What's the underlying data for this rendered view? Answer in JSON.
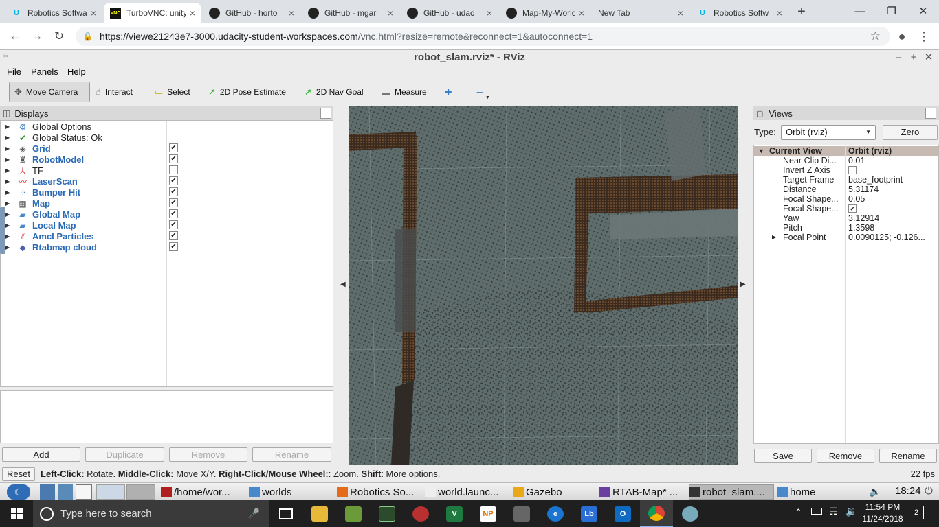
{
  "browser": {
    "tabs": [
      {
        "title": "Robotics Software",
        "icon": "udacity-icon",
        "active": false
      },
      {
        "title": "TurboVNC: unity",
        "icon": "turbovnc-icon",
        "active": true
      },
      {
        "title": "GitHub - horto",
        "icon": "github-icon",
        "active": false
      },
      {
        "title": "GitHub - mgar",
        "icon": "github-icon",
        "active": false
      },
      {
        "title": "GitHub - udac",
        "icon": "github-icon",
        "active": false
      },
      {
        "title": "Map-My-World",
        "icon": "github-icon",
        "active": false
      },
      {
        "title": "New Tab",
        "icon": "",
        "active": false
      },
      {
        "title": "Robotics Softw",
        "icon": "udacity-icon",
        "active": false
      }
    ],
    "new_tab": "+",
    "url_host": "https://viewe21243e7-3000.udacity-student-workspaces.com",
    "url_rest": "/vnc.html?resize=remote&reconnect=1&autoconnect=1"
  },
  "rviz": {
    "title": "robot_slam.rviz* - RViz",
    "menus": [
      "File",
      "Panels",
      "Help"
    ],
    "tools": [
      {
        "label": "Move Camera",
        "icon": "move-camera-icon",
        "glyph": "✥"
      },
      {
        "label": "Interact",
        "icon": "hand-icon",
        "glyph": "☝"
      },
      {
        "label": "Select",
        "icon": "select-icon",
        "glyph": "▭"
      },
      {
        "label": "2D Pose Estimate",
        "icon": "pose-arrow-icon",
        "glyph": "➚"
      },
      {
        "label": "2D Nav Goal",
        "icon": "nav-goal-icon",
        "glyph": "➚"
      },
      {
        "label": "Measure",
        "icon": "ruler-icon",
        "glyph": "▬"
      }
    ],
    "displays": {
      "header": "Displays",
      "items": [
        {
          "label": "Global Options",
          "bold": false,
          "checkbox": null,
          "icon": "gear-icon",
          "glyph": "⚙",
          "color": "#3a7fc4"
        },
        {
          "label": "Global Status: Ok",
          "bold": false,
          "checkbox": null,
          "icon": "check-icon",
          "glyph": "✔",
          "color": "#2a8a2a"
        },
        {
          "label": "Grid",
          "bold": true,
          "checkbox": true,
          "icon": "grid-icon",
          "glyph": "◈",
          "color": "#555"
        },
        {
          "label": "RobotModel",
          "bold": true,
          "checkbox": true,
          "icon": "robot-icon",
          "glyph": "♜",
          "color": "#555"
        },
        {
          "label": "TF",
          "bold": false,
          "checkbox": false,
          "icon": "tf-axes-icon",
          "glyph": "⅄",
          "color": "#c44"
        },
        {
          "label": "LaserScan",
          "bold": true,
          "checkbox": true,
          "icon": "laser-icon",
          "glyph": "〰",
          "color": "#d22"
        },
        {
          "label": "Bumper Hit",
          "bold": true,
          "checkbox": true,
          "icon": "points-icon",
          "glyph": "⁘",
          "color": "#3a7fc4"
        },
        {
          "label": "Map",
          "bold": true,
          "checkbox": true,
          "icon": "map-icon",
          "glyph": "▦",
          "color": "#555"
        },
        {
          "label": "Global Map",
          "bold": true,
          "checkbox": true,
          "icon": "folder-icon",
          "glyph": "▰",
          "color": "#4a88cc"
        },
        {
          "label": "Local Map",
          "bold": true,
          "checkbox": true,
          "icon": "folder-icon",
          "glyph": "▰",
          "color": "#4a88cc"
        },
        {
          "label": "Amcl Particles",
          "bold": true,
          "checkbox": true,
          "icon": "pose-array-icon",
          "glyph": "⫽",
          "color": "#d22"
        },
        {
          "label": "Rtabmap cloud",
          "bold": true,
          "checkbox": true,
          "icon": "cloud-icon",
          "glyph": "◆",
          "color": "#5060b0"
        }
      ],
      "buttons": {
        "add": "Add",
        "duplicate": "Duplicate",
        "remove": "Remove",
        "rename": "Rename"
      }
    },
    "views": {
      "header": "Views",
      "type_label": "Type:",
      "type_value": "Orbit (rviz)",
      "zero": "Zero",
      "current_view_label": "Current View",
      "current_view_value": "Orbit (rviz)",
      "props": [
        {
          "key": "Near Clip Di...",
          "value": "0.01"
        },
        {
          "key": "Invert Z Axis",
          "value": "",
          "checkbox": false
        },
        {
          "key": "Target Frame",
          "value": "base_footprint"
        },
        {
          "key": "Distance",
          "value": "5.31174"
        },
        {
          "key": "Focal Shape...",
          "value": "0.05"
        },
        {
          "key": "Focal Shape...",
          "value": "",
          "checkbox": true
        },
        {
          "key": "Yaw",
          "value": "3.12914"
        },
        {
          "key": "Pitch",
          "value": "1.3598"
        },
        {
          "key": "Focal Point",
          "value": "0.0090125; -0.126...",
          "expandable": true
        }
      ],
      "buttons": {
        "save": "Save",
        "remove": "Remove",
        "rename": "Rename"
      }
    },
    "status": {
      "reset": "Reset",
      "b1": "Left-Click:",
      "t1": " Rotate. ",
      "b2": "Middle-Click:",
      "t2": " Move X/Y. ",
      "b3": "Right-Click/Mouse Wheel:",
      "t3": ": Zoom. ",
      "b4": "Shift",
      "t4": ": More options.",
      "fps": "22 fps"
    }
  },
  "xfce_panel": {
    "tasks": [
      "/home/wor...",
      "worlds",
      "Robotics So...",
      "world.launc...",
      "Gazebo",
      "RTAB-Map* ...",
      "robot_slam....",
      "home"
    ],
    "clock": "18:24"
  },
  "windows_taskbar": {
    "search_placeholder": "Type here to search",
    "time": "11:54 PM",
    "date": "11/24/2018",
    "notification_count": "2"
  }
}
